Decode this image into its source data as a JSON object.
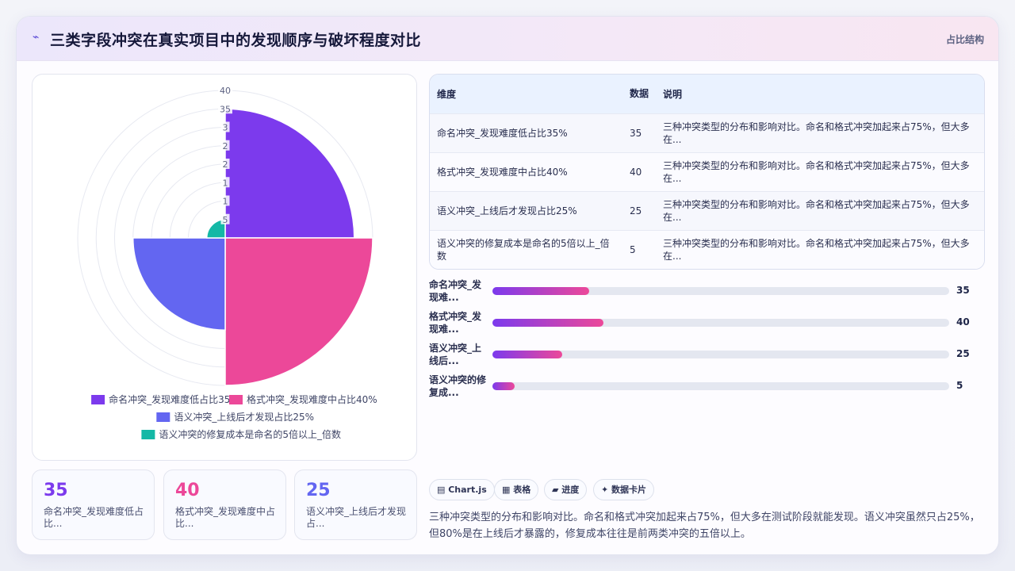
{
  "header": {
    "icon": "bolt-icon",
    "title": "三类字段冲突在真实项目中的发现顺序与破坏程度对比",
    "tag": "占比结构"
  },
  "chart_data": {
    "type": "polarArea",
    "categories": [
      "命名冲突_发现难度低占比35%",
      "格式冲突_发现难度中占比40%",
      "语义冲突_上线后才发现占比25%",
      "语义冲突的修复成本是命名的5倍以上_倍数"
    ],
    "values": [
      35,
      40,
      25,
      5
    ],
    "colors": [
      "#7c3aed",
      "#ec4899",
      "#6366f1",
      "#14b8a6"
    ],
    "r_ticks": [
      5,
      10,
      15,
      20,
      25,
      30,
      35,
      40
    ],
    "r_tick_labels": [
      "5",
      "1",
      "1",
      "2",
      "2",
      "3",
      "35",
      "40"
    ],
    "rlim": [
      0,
      40
    ],
    "legend": "bottom"
  },
  "stats": [
    {
      "value": "35",
      "label": "命名冲突_发现难度低占比...",
      "color": "#7c3aed"
    },
    {
      "value": "40",
      "label": "格式冲突_发现难度中占比...",
      "color": "#ec4899"
    },
    {
      "value": "25",
      "label": "语义冲突_上线后才发现占...",
      "color": "#6366f1"
    }
  ],
  "table": {
    "headers": [
      "维度",
      "数据",
      "说明"
    ],
    "rows": [
      {
        "dim": "命名冲突_发现难度低占比35%",
        "val": "35",
        "note": "三种冲突类型的分布和影响对比。命名和格式冲突加起来占75%，但大多在..."
      },
      {
        "dim": "格式冲突_发现难度中占比40%",
        "val": "40",
        "note": "三种冲突类型的分布和影响对比。命名和格式冲突加起来占75%，但大多在..."
      },
      {
        "dim": "语义冲突_上线后才发现占比25%",
        "val": "25",
        "note": "三种冲突类型的分布和影响对比。命名和格式冲突加起来占75%，但大多在..."
      },
      {
        "dim": "语义冲突的修复成本是命名的5倍以上_倍数",
        "val": "5",
        "note": "三种冲突类型的分布和影响对比。命名和格式冲突加起来占75%，但大多在..."
      }
    ]
  },
  "bars": [
    {
      "label": "命名冲突_发现难...",
      "value": "35",
      "fraction": 0.2125
    },
    {
      "label": "格式冲突_发现难...",
      "value": "40",
      "fraction": 0.2431
    },
    {
      "label": "语义冲突_上线后...",
      "value": "25",
      "fraction": 0.1528
    },
    {
      "label": "语义冲突的修复成...",
      "value": "5",
      "fraction": 0.0486
    }
  ],
  "chips": [
    "Chart.js",
    "表格",
    "进度",
    "数据卡片"
  ],
  "summary": "三种冲突类型的分布和影响对比。命名和格式冲突加起来占75%，但大多在测试阶段就能发现。语义冲突虽然只占25%，但80%是在上线后才暴露的，修复成本往往是前两类冲突的五倍以上。"
}
